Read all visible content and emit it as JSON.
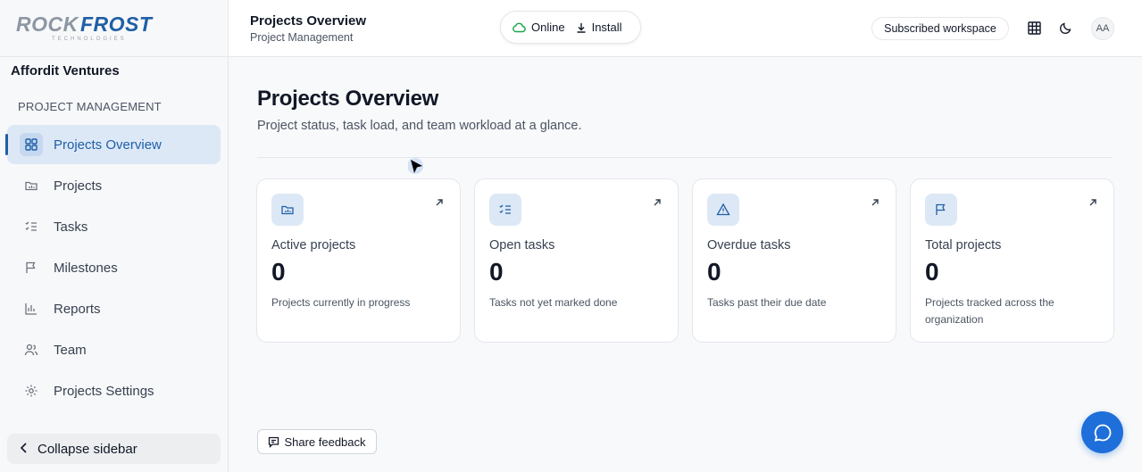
{
  "brand": {
    "logo_text": "ROCK FROST",
    "logo_sub": "TECHNOLOGIES"
  },
  "sidebar": {
    "org_name": "Affordit Ventures",
    "section_label": "PROJECT MANAGEMENT",
    "items": [
      {
        "label": "Projects Overview",
        "icon": "grid-icon",
        "active": true
      },
      {
        "label": "Projects",
        "icon": "folder-icon",
        "active": false
      },
      {
        "label": "Tasks",
        "icon": "checklist-icon",
        "active": false
      },
      {
        "label": "Milestones",
        "icon": "flag-icon",
        "active": false
      },
      {
        "label": "Reports",
        "icon": "bar-chart-icon",
        "active": false
      },
      {
        "label": "Team",
        "icon": "users-icon",
        "active": false
      },
      {
        "label": "Projects Settings",
        "icon": "gear-icon",
        "active": false
      }
    ],
    "collapse_label": "Collapse sidebar"
  },
  "header": {
    "title": "Projects Overview",
    "subtitle": "Project Management",
    "status_label": "Online",
    "install_label": "Install",
    "subscription_label": "Subscribed workspace",
    "avatar_initials": "AA"
  },
  "main": {
    "title": "Projects Overview",
    "subtitle": "Project status, task load, and team workload at a glance.",
    "cards": [
      {
        "label": "Active projects",
        "value": "0",
        "description": "Projects currently in progress",
        "icon": "folder-icon"
      },
      {
        "label": "Open tasks",
        "value": "0",
        "description": "Tasks not yet marked done",
        "icon": "checklist-icon"
      },
      {
        "label": "Overdue tasks",
        "value": "0",
        "description": "Tasks past their due date",
        "icon": "warning-icon"
      },
      {
        "label": "Total projects",
        "value": "0",
        "description": "Projects tracked across the organization",
        "icon": "flag-icon"
      }
    ],
    "feedback_label": "Share feedback"
  },
  "colors": {
    "accent": "#1e5fa8",
    "accent_bg": "#dde8f6",
    "fab": "#1e6fd9",
    "online": "#16a34a"
  }
}
